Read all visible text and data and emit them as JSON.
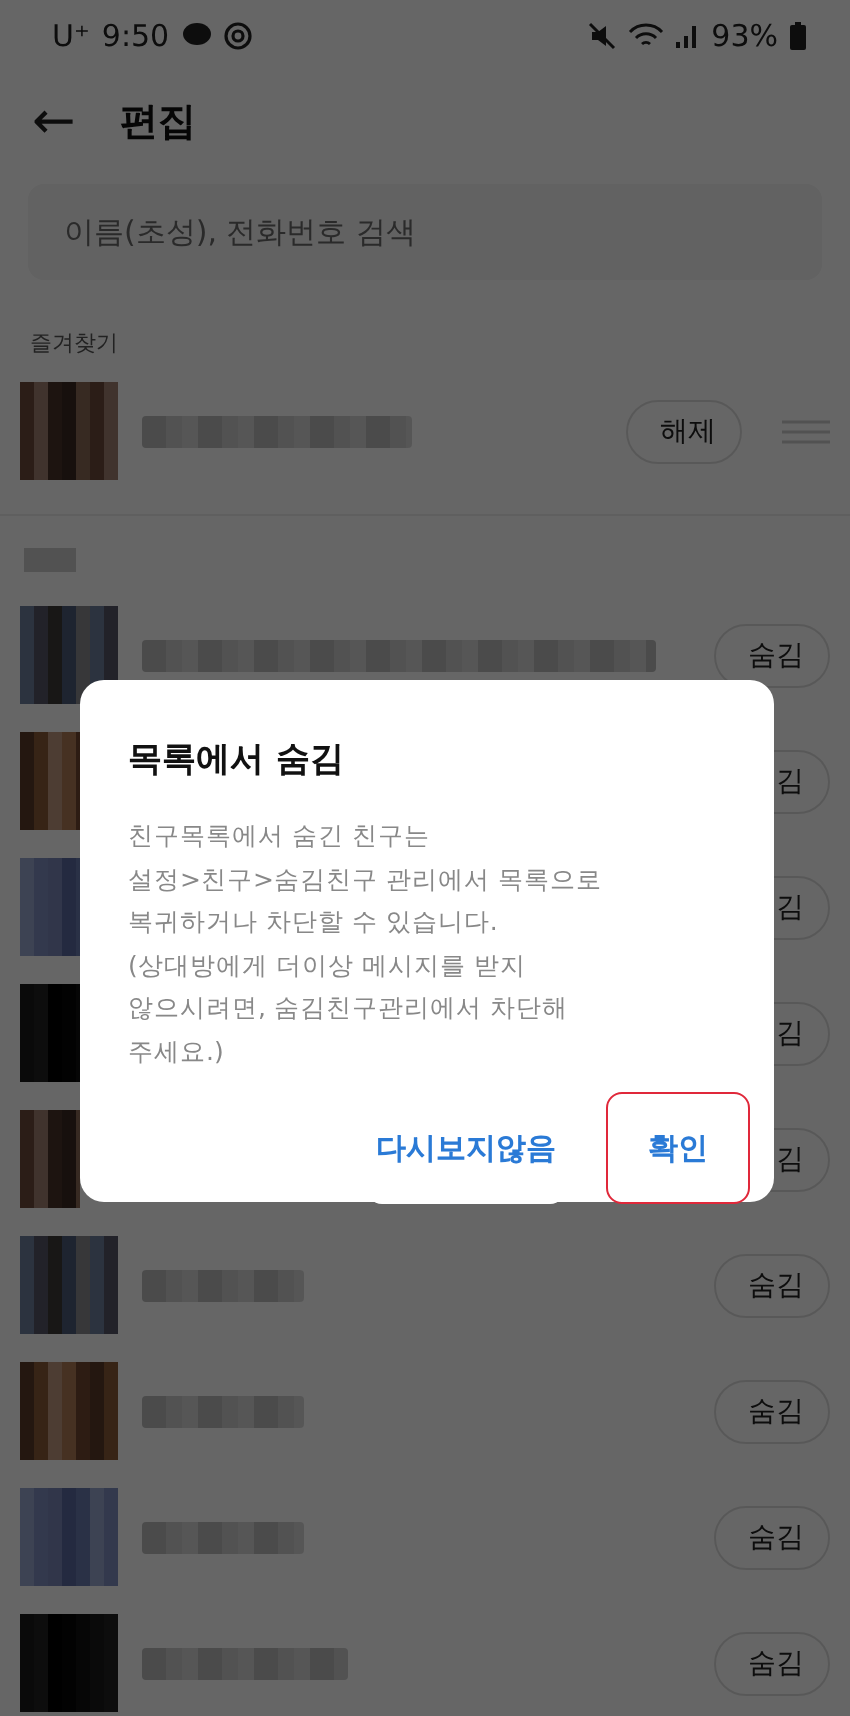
{
  "status_bar": {
    "carrier": "U⁺",
    "time": "9:50",
    "battery": "93%"
  },
  "header": {
    "back": "←",
    "title": "편집"
  },
  "search": {
    "placeholder": "이름(초성), 전화번호 검색"
  },
  "favorites": {
    "label": "즐겨찾기",
    "rows": [
      {
        "action": "해제"
      }
    ]
  },
  "friends": {
    "rows": [
      {
        "action": "숨김"
      },
      {
        "action": "김"
      },
      {
        "action": "김"
      },
      {
        "action": "김"
      },
      {
        "action": "김"
      },
      {
        "action": "숨김"
      },
      {
        "action": "숨김"
      },
      {
        "action": "숨김"
      },
      {
        "action": "숨김"
      }
    ]
  },
  "dialog": {
    "title": "목록에서 숨김",
    "body": [
      "친구목록에서 숨긴 친구는",
      "설정>친구>숨김친구 관리에서 목록으로",
      "복귀하거나 차단할 수 있습니다.",
      "(상대방에게 더이상 메시지를 받지",
      "않으시려면, 숨김친구관리에서 차단해",
      "주세요.)"
    ],
    "buttons": [
      {
        "label": "다시보지않음",
        "highlighted": false
      },
      {
        "label": "확인",
        "highlighted": true
      }
    ]
  }
}
